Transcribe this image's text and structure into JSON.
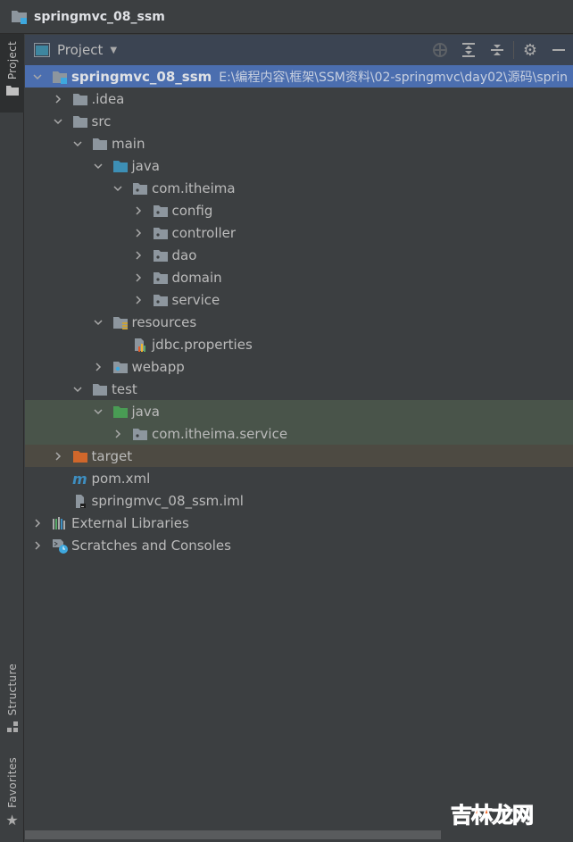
{
  "window": {
    "title": "springmvc_08_ssm"
  },
  "sidebar": {
    "top_tabs": [
      {
        "label": "Project",
        "icon": "folder-icon",
        "active": true
      }
    ],
    "bottom_tabs": [
      {
        "label": "Structure",
        "icon": "structure-icon"
      },
      {
        "label": "Favorites",
        "icon": "star-icon"
      }
    ]
  },
  "panel": {
    "title": "Project",
    "toolbar": [
      "locate-icon",
      "expand-all-icon",
      "collapse-all-icon",
      "gear-icon",
      "minimize-icon"
    ]
  },
  "tree": [
    {
      "label": "springmvc_08_ssm",
      "path": "E:\\编程内容\\框架\\SSM资料\\02-springmvc\\day02\\源码\\sprin",
      "depth": 0,
      "expanded": true,
      "icon": "module-folder-icon",
      "selected": true
    },
    {
      "label": ".idea",
      "depth": 1,
      "expanded": false,
      "icon": "folder-icon"
    },
    {
      "label": "src",
      "depth": 1,
      "expanded": true,
      "icon": "folder-icon"
    },
    {
      "label": "main",
      "depth": 2,
      "expanded": true,
      "icon": "folder-icon"
    },
    {
      "label": "java",
      "depth": 3,
      "expanded": true,
      "icon": "source-folder-icon"
    },
    {
      "label": "com.itheima",
      "depth": 4,
      "expanded": true,
      "icon": "package-icon"
    },
    {
      "label": "config",
      "depth": 5,
      "expanded": false,
      "icon": "package-icon"
    },
    {
      "label": "controller",
      "depth": 5,
      "expanded": false,
      "icon": "package-icon"
    },
    {
      "label": "dao",
      "depth": 5,
      "expanded": false,
      "icon": "package-icon"
    },
    {
      "label": "domain",
      "depth": 5,
      "expanded": false,
      "icon": "package-icon"
    },
    {
      "label": "service",
      "depth": 5,
      "expanded": false,
      "icon": "package-icon"
    },
    {
      "label": "resources",
      "depth": 3,
      "expanded": true,
      "icon": "resources-folder-icon"
    },
    {
      "label": "jdbc.properties",
      "depth": 4,
      "icon": "properties-file-icon"
    },
    {
      "label": "webapp",
      "depth": 3,
      "expanded": false,
      "icon": "web-folder-icon"
    },
    {
      "label": "test",
      "depth": 2,
      "expanded": true,
      "icon": "folder-icon"
    },
    {
      "label": "java",
      "depth": 3,
      "expanded": true,
      "icon": "test-source-folder-icon",
      "highlight": "test"
    },
    {
      "label": "com.itheima.service",
      "depth": 4,
      "expanded": false,
      "icon": "package-icon",
      "highlight": "test"
    },
    {
      "label": "target",
      "depth": 1,
      "expanded": false,
      "icon": "excluded-folder-icon",
      "highlight": "target"
    },
    {
      "label": "pom.xml",
      "depth": 1,
      "icon": "maven-icon"
    },
    {
      "label": "springmvc_08_ssm.iml",
      "depth": 1,
      "icon": "iml-file-icon"
    },
    {
      "label": "External Libraries",
      "depth": 0,
      "expanded": false,
      "icon": "libraries-icon"
    },
    {
      "label": "Scratches and Consoles",
      "depth": 0,
      "expanded": false,
      "icon": "scratches-icon"
    }
  ],
  "watermark": {
    "part1": "吉林",
    "part2": "龙网"
  },
  "colors": {
    "selection": "#4b6eaf",
    "test_highlight": "#49544a",
    "target_highlight": "#4d4a42",
    "source_folder": "#3d8fb5",
    "test_folder": "#499c54",
    "excluded_folder": "#d0672b"
  }
}
